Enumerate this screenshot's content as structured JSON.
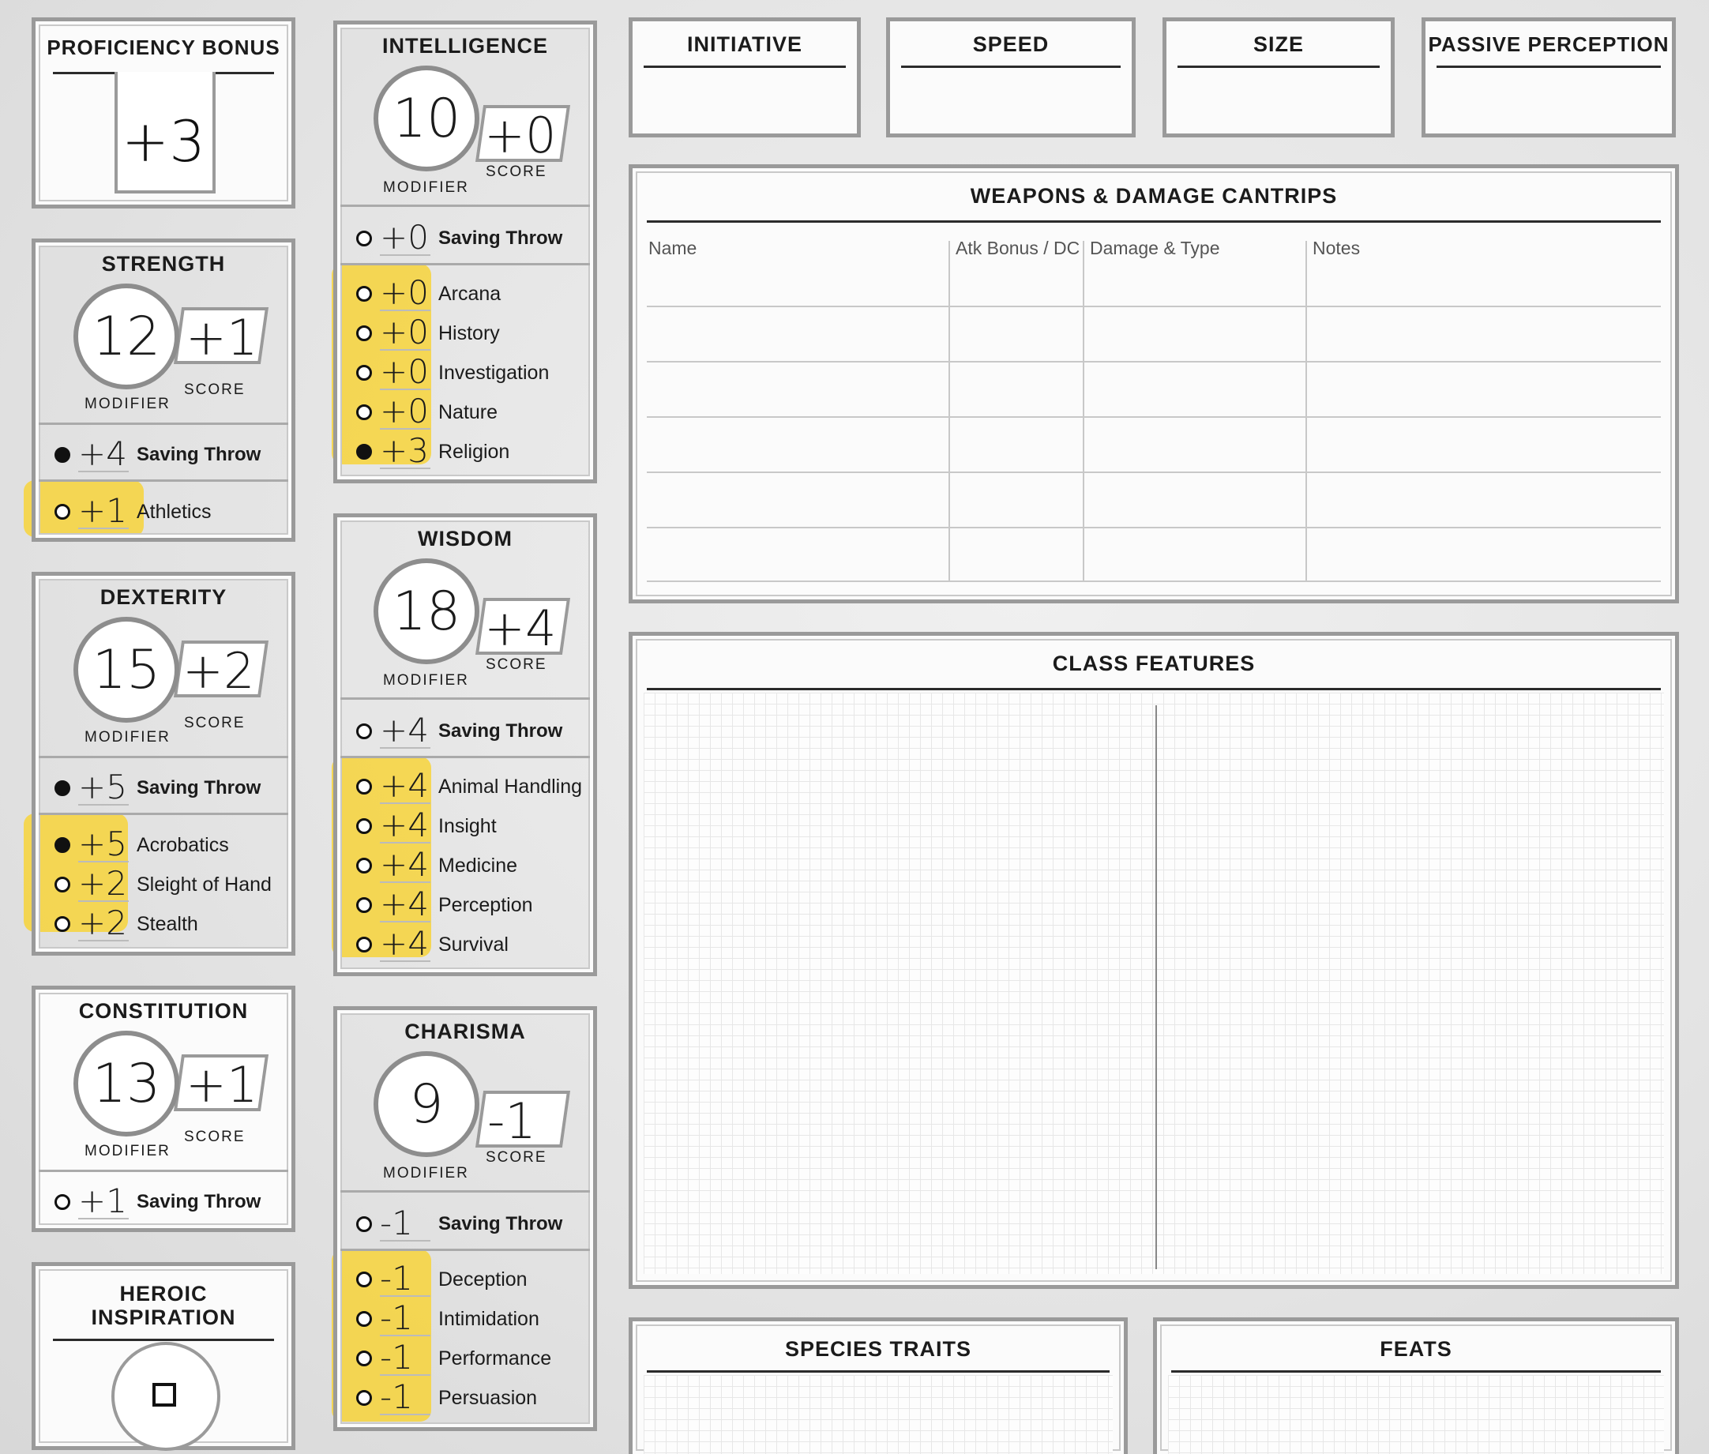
{
  "proficiency": {
    "title": "PROFICIENCY BONUS",
    "value": "+3"
  },
  "heroic": {
    "line1": "HEROIC",
    "line2": "INSPIRATION"
  },
  "labels": {
    "modifier": "MODIFIER",
    "score": "SCORE",
    "saving_throw": "Saving Throw"
  },
  "strength": {
    "title": "STRENGTH",
    "score": "12",
    "modifier": "+1",
    "save": "+4",
    "skills": [
      {
        "value": "+1",
        "name": "Athletics"
      }
    ]
  },
  "dexterity": {
    "title": "DEXTERITY",
    "score": "15",
    "modifier": "+2",
    "save": "+5",
    "skills": [
      {
        "value": "+5",
        "name": "Acrobatics"
      },
      {
        "value": "+2",
        "name": "Sleight of Hand"
      },
      {
        "value": "+2",
        "name": "Stealth"
      }
    ]
  },
  "constitution": {
    "title": "CONSTITUTION",
    "score": "13",
    "modifier": "+1",
    "save": "+1"
  },
  "intelligence": {
    "title": "INTELLIGENCE",
    "score": "10",
    "modifier": "+0",
    "save": "+0",
    "skills": [
      {
        "value": "+0",
        "name": "Arcana"
      },
      {
        "value": "+0",
        "name": "History"
      },
      {
        "value": "+0",
        "name": "Investigation"
      },
      {
        "value": "+0",
        "name": "Nature"
      },
      {
        "value": "+3",
        "name": "Religion"
      }
    ]
  },
  "wisdom": {
    "title": "WISDOM",
    "score": "18",
    "modifier": "+4",
    "save": "+4",
    "skills": [
      {
        "value": "+4",
        "name": "Animal Handling"
      },
      {
        "value": "+4",
        "name": "Insight"
      },
      {
        "value": "+4",
        "name": "Medicine"
      },
      {
        "value": "+4",
        "name": "Perception"
      },
      {
        "value": "+4",
        "name": "Survival"
      }
    ]
  },
  "charisma": {
    "title": "CHARISMA",
    "score": "9",
    "modifier": "-1",
    "save": "-1",
    "skills": [
      {
        "value": "-1",
        "name": "Deception"
      },
      {
        "value": "-1",
        "name": "Intimidation"
      },
      {
        "value": "-1",
        "name": "Performance"
      },
      {
        "value": "-1",
        "name": "Persuasion"
      }
    ]
  },
  "top": {
    "initiative": "INITIATIVE",
    "speed": "SPEED",
    "size": "SIZE",
    "passive": "PASSIVE PERCEPTION"
  },
  "weapons": {
    "title": "WEAPONS & DAMAGE CANTRIPS",
    "col_name": "Name",
    "col_atk": "Atk Bonus / DC",
    "col_damage": "Damage & Type",
    "col_notes": "Notes"
  },
  "class_features": {
    "title": "CLASS FEATURES"
  },
  "species": {
    "title": "SPECIES TRAITS"
  },
  "feats": {
    "title": "FEATS"
  },
  "colors": {
    "highlight": "#f7d33a",
    "frame": "#9a9a9a"
  }
}
